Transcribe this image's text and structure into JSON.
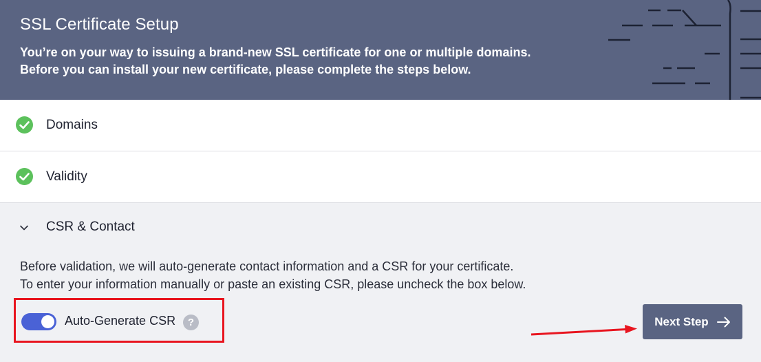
{
  "header": {
    "title": "SSL Certificate Setup",
    "description_line1": "You’re on your way to issuing a brand-new SSL certificate for one or multiple domains.",
    "description_line2": "Before you can install your new certificate, please complete the steps below."
  },
  "steps": [
    {
      "label": "Domains",
      "status": "complete",
      "icon": "check-circle-icon"
    },
    {
      "label": "Validity",
      "status": "complete",
      "icon": "check-circle-icon"
    }
  ],
  "csr_section": {
    "title": "CSR & Contact",
    "expanded": true,
    "description_line1": "Before validation, we will auto-generate contact information and a CSR for your certificate.",
    "description_line2": "To enter your information manually or paste an existing CSR, please uncheck the box below.",
    "toggle": {
      "label": "Auto-Generate CSR",
      "checked": true,
      "help_glyph": "?"
    },
    "next_button": {
      "label": "Next Step",
      "icon": "arrow-right-icon"
    }
  },
  "colors": {
    "header_bg": "#5a6482",
    "success": "#5cc15c",
    "toggle_on": "#4a62d6",
    "annotation": "#e8151f"
  }
}
